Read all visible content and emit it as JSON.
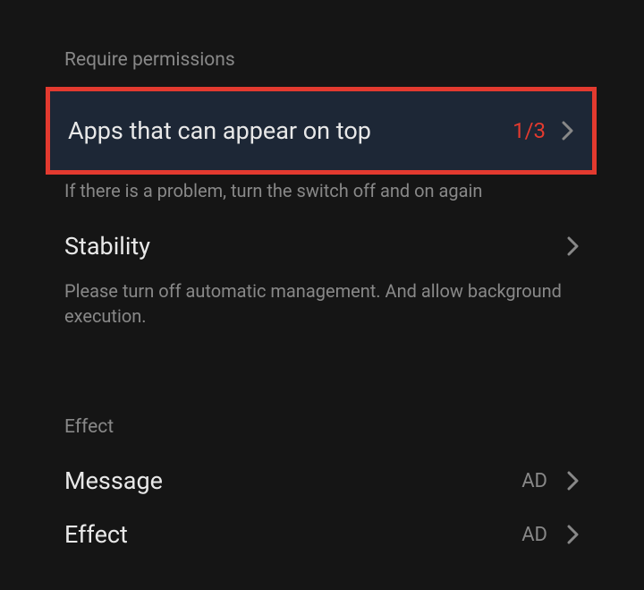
{
  "sections": {
    "permissions": {
      "header": "Require permissions",
      "items": [
        {
          "title": "Apps that can appear on top",
          "value": "1/3",
          "description": "If there is a problem, turn the switch off and on again"
        },
        {
          "title": "Stability",
          "description": "Please turn off automatic management. And allow background execution."
        }
      ]
    },
    "effect": {
      "header": "Effect",
      "items": [
        {
          "title": "Message",
          "badge": "AD"
        },
        {
          "title": "Effect",
          "badge": "AD"
        }
      ]
    }
  }
}
